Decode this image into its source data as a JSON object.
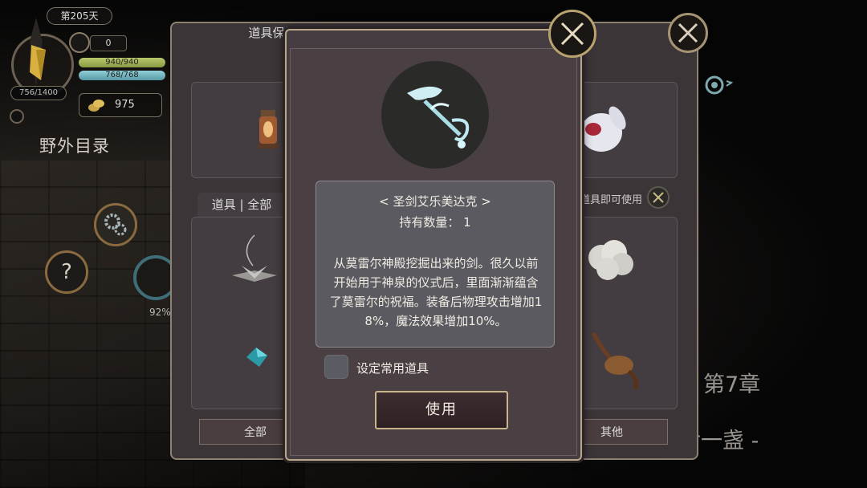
{
  "hud": {
    "day": "第205天",
    "hp": "756/1400",
    "counter": "0",
    "stamina": "940/940",
    "mana": "768/768",
    "gold": "975",
    "field_directory": "野外目录",
    "help_symbol": "?",
    "progress_pct": "92%"
  },
  "scene": {
    "chapter": "第7章",
    "lamp_text": "后一盏 -"
  },
  "back_panel": {
    "title": "道具保管箱",
    "filter_tab": "道具 | 全部",
    "use_hint": "道具即可使用",
    "tab_all": "全部",
    "tab_other": "其他"
  },
  "dialog": {
    "item_name": "< 圣剑艾乐美达克 >",
    "quantity_label": "持有数量：",
    "quantity_value": "1",
    "description": "从莫雷尔神殿挖掘出来的剑。很久以前开始用于神泉的仪式后，里面渐渐蕴含了莫雷尔的祝福。装备后物理攻击增加18%，魔法效果增加10%。",
    "favorite_label": "设定常用道具",
    "use_button": "使用"
  },
  "colors": {
    "panel_bg": "#463d42",
    "info_box": "#5b5a60",
    "gold_border": "#b9a98a",
    "stamina": "#b8c86a",
    "mana": "#8fd0d8"
  }
}
